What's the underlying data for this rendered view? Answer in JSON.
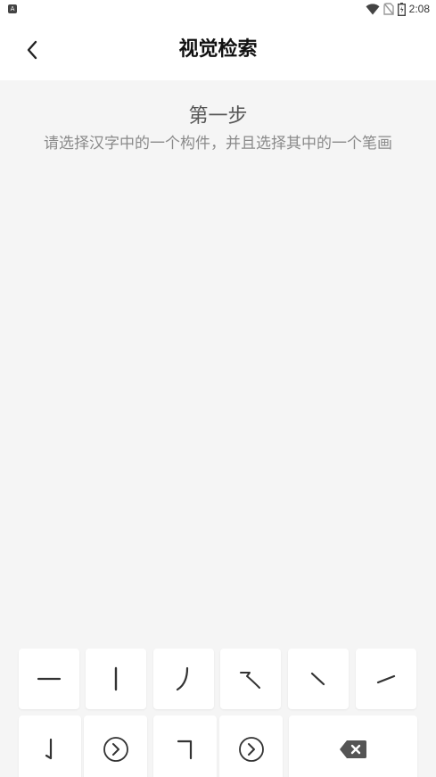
{
  "status_bar": {
    "time": "2:08",
    "left_badge": "A",
    "icons": [
      "wifi-icon",
      "no-sim-icon",
      "battery-icon"
    ]
  },
  "app_bar": {
    "title": "视觉检索",
    "back_icon": "chevron-left-icon"
  },
  "step": {
    "title": "第一步",
    "description": "请选择汉字中的一个构件，并且选择其中的一个笔画"
  },
  "keyboard": {
    "row1": [
      "stroke-heng",
      "stroke-shu",
      "stroke-pie",
      "stroke-hengpie",
      "stroke-dian",
      "stroke-ti"
    ],
    "row2": [
      "stroke-shugou",
      "more-arrow",
      "stroke-hengzhe",
      "more-arrow",
      "backspace"
    ]
  },
  "colors": {
    "background": "#f5f5f5",
    "surface": "#ffffff",
    "text_primary": "#111111",
    "text_secondary": "#8a8a8a",
    "icon": "#333333"
  }
}
